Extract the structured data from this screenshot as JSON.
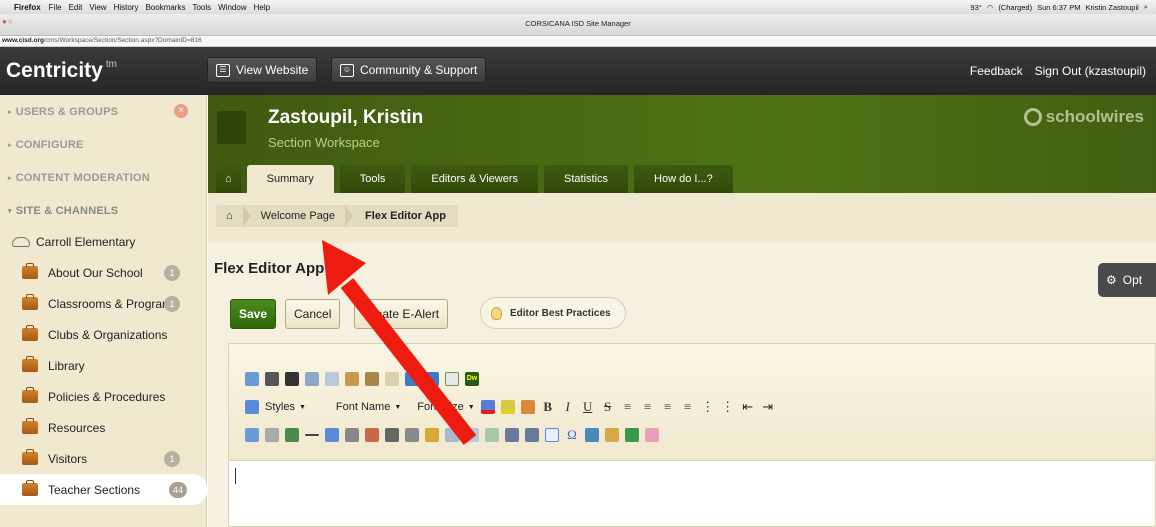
{
  "macbar": {
    "app": "Firefox",
    "menus": [
      "File",
      "Edit",
      "View",
      "History",
      "Bookmarks",
      "Tools",
      "Window",
      "Help"
    ],
    "status": "93°",
    "battery": "(Charged)",
    "datetime": "Sun 6:37 PM",
    "user": "Kristin Zastoupil"
  },
  "window": {
    "title": "CORSICANA ISD Site Manager",
    "url_host": "www.cisd.org",
    "url_path": "/cms/Workspace/Section/Section.aspx?DomainID=816"
  },
  "header": {
    "logo": "Centricity",
    "logo_tm": "tm",
    "view_website": "View Website",
    "community": "Community & Support",
    "feedback": "Feedback",
    "signout": "Sign Out (kzastoupil)"
  },
  "sidebar": {
    "sections": [
      "USERS & GROUPS",
      "CONFIGURE",
      "CONTENT MODERATION",
      "SITE & CHANNELS"
    ],
    "site": "Carroll Elementary",
    "items": [
      {
        "label": "About Our School",
        "count": "1"
      },
      {
        "label": "Classrooms & Program",
        "count": "1"
      },
      {
        "label": "Clubs & Organizations",
        "count": ""
      },
      {
        "label": "Library",
        "count": ""
      },
      {
        "label": "Policies & Procedures",
        "count": ""
      },
      {
        "label": "Resources",
        "count": ""
      },
      {
        "label": "Visitors",
        "count": "1"
      },
      {
        "label": "Teacher Sections",
        "count": "44"
      }
    ]
  },
  "banner": {
    "name": "Zastoupil, Kristin",
    "subtitle": "Section Workspace",
    "brand": "schoolwires",
    "tabs": [
      "Summary",
      "Tools",
      "Editors & Viewers",
      "Statistics",
      "How do I...?"
    ]
  },
  "breadcrumb": [
    "Welcome Page",
    "Flex Editor App"
  ],
  "main": {
    "title": "Flex Editor App",
    "save": "Save",
    "cancel": "Cancel",
    "ealert": "Create E-Alert",
    "best_practices": "Editor Best Practices",
    "options": "Opt"
  },
  "editor": {
    "styles": "Styles",
    "font_name": "Font Name",
    "font_size": "Font Size"
  },
  "colors": {
    "accent_green": "#4e7314",
    "annotation_red": "#ee1c10"
  }
}
